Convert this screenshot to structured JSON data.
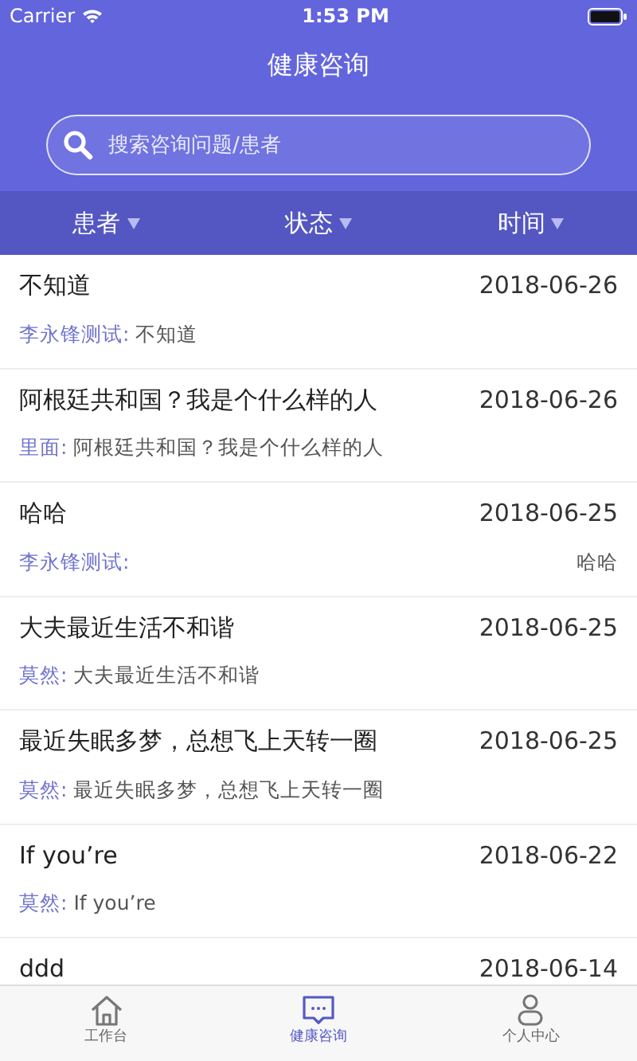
{
  "status_bar": {
    "carrier": "Carrier",
    "time": "1:53 PM"
  },
  "header": {
    "title": "健康咨询"
  },
  "search": {
    "placeholder": "搜索咨询问题/患者"
  },
  "filters": [
    {
      "label": "患者"
    },
    {
      "label": "状态"
    },
    {
      "label": "时间"
    }
  ],
  "consultations": [
    {
      "title": "不知道",
      "date": "2018-06-26",
      "patient": "李永锋测试:",
      "message": "不知道",
      "kind": "inline"
    },
    {
      "title": "阿根廷共和国？我是个什么样的人",
      "date": "2018-06-26",
      "patient": "里面:",
      "message": "阿根廷共和国？我是个什么样的人",
      "kind": "inline"
    },
    {
      "title": "哈哈",
      "date": "2018-06-25",
      "patient": "李永锋测试:",
      "message": "哈哈",
      "kind": "split"
    },
    {
      "title": "大夫最近生活不和谐",
      "date": "2018-06-25",
      "patient": "莫然:",
      "message": "大夫最近生活不和谐",
      "kind": "inline"
    },
    {
      "title": "最近失眠多梦，总想飞上天转一圈",
      "date": "2018-06-25",
      "patient": "莫然:",
      "message": "最近失眠多梦，总想飞上天转一圈",
      "kind": "inline"
    },
    {
      "title": "If you’re",
      "date": "2018-06-22",
      "patient": "莫然:",
      "message": "If you’re",
      "kind": "inline"
    },
    {
      "title": "ddd",
      "date": "2018-06-14"
    }
  ],
  "tab_bar": [
    {
      "label": "工作台",
      "kind": "home",
      "selected": false
    },
    {
      "label": "健康咨询",
      "kind": "chat",
      "selected": true
    },
    {
      "label": "个人中心",
      "kind": "person",
      "selected": false
    }
  ]
}
